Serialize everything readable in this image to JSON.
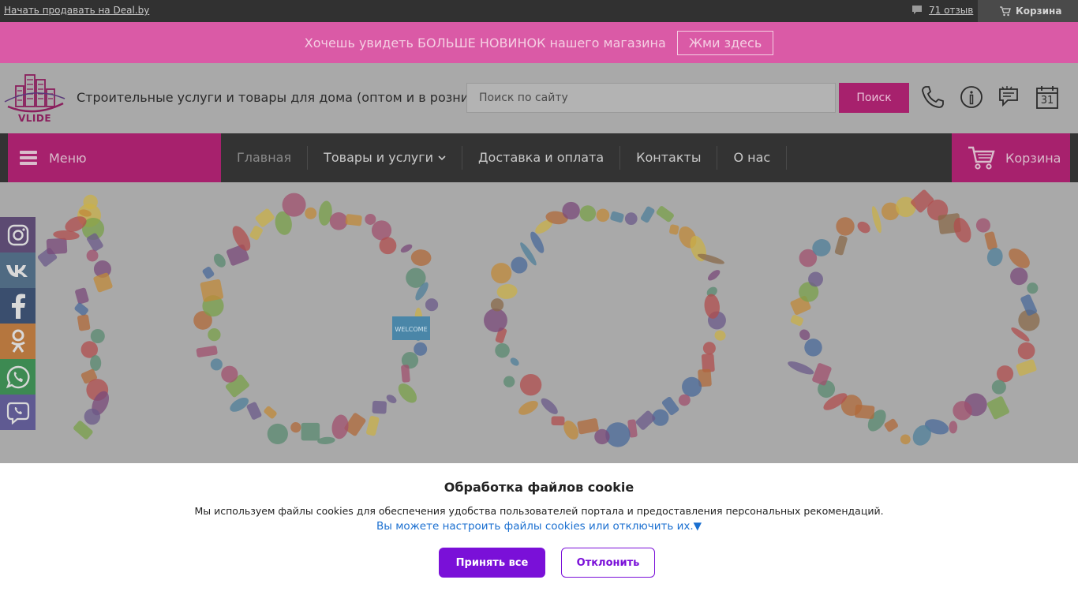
{
  "topbar": {
    "sell_link": "Начать продавать на Deal.by",
    "reviews": "71 отзыв",
    "cart": "Корзина"
  },
  "promo": {
    "text": "Хочешь увидеть БОЛЬШЕ НОВИНОК нашего магазина",
    "button": "Жми здесь"
  },
  "header": {
    "logo_text": "VLIDE",
    "title": "Строительные услуги и товары для дома (оптом и в розницу)",
    "search_placeholder": "Поиск по сайту",
    "search_button": "Поиск",
    "icons": [
      "phone-icon",
      "info-icon",
      "chat-icon",
      "calendar-icon"
    ],
    "calendar_day": "31"
  },
  "nav": {
    "menu": "Меню",
    "items": [
      {
        "label": "Главная",
        "active": true
      },
      {
        "label": "Товары и услуги",
        "dropdown": true
      },
      {
        "label": "Доставка и оплата"
      },
      {
        "label": "Контакты"
      },
      {
        "label": "О нас"
      }
    ],
    "cart": "Корзина"
  },
  "hero": {
    "welcome_sign": "WELCOME"
  },
  "social": [
    "instagram-icon",
    "vk-icon",
    "facebook-icon",
    "odnoklassniki-icon",
    "whatsapp-icon",
    "viber-icon"
  ],
  "cookie": {
    "title": "Обработка файлов cookie",
    "text": "Мы используем файлы cookies для обеспечения удобства пользователей портала и предоставления персональных рекомендаций.",
    "link": "Вы можете настроить файлы cookies или отключить их.▼",
    "accept": "Принять все",
    "decline": "Отклонить"
  },
  "colors": {
    "accent": "#a7216d",
    "promo": "#da5aa6",
    "topbar": "#313131",
    "nav": "#333333",
    "cookie_button": "#7a10d8",
    "cookie_link": "#1a6fd0"
  }
}
